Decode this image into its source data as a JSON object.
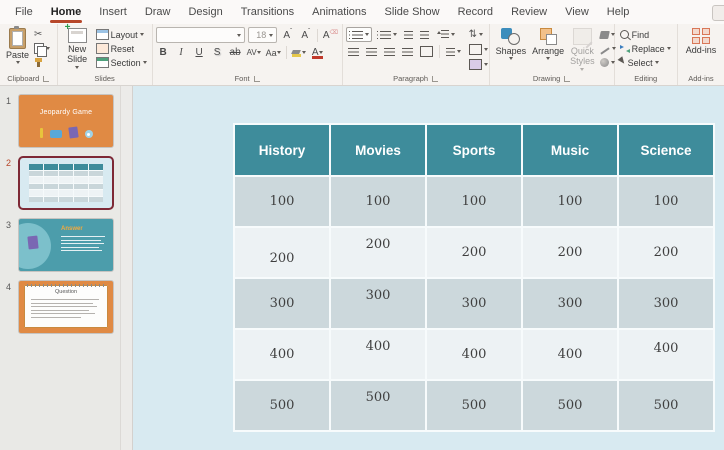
{
  "menu": {
    "tabs": [
      "File",
      "Home",
      "Insert",
      "Draw",
      "Design",
      "Transitions",
      "Animations",
      "Slide Show",
      "Record",
      "Review",
      "View",
      "Help"
    ]
  },
  "ribbon": {
    "clipboard": {
      "paste": "Paste",
      "label": "Clipboard"
    },
    "slides": {
      "new_slide": "New Slide",
      "layout": "Layout",
      "reset": "Reset",
      "section": "Section",
      "label": "Slides"
    },
    "font": {
      "size": "18",
      "grow": "A",
      "shrink": "A",
      "clear": "A",
      "bold": "B",
      "italic": "I",
      "underline": "U",
      "shadow": "S",
      "strike_ab": "ab",
      "spacing": "AV",
      "case": "Aa",
      "color": "A",
      "label": "Font"
    },
    "paragraph": {
      "label": "Paragraph"
    },
    "drawing": {
      "shapes": "Shapes",
      "arrange": "Arrange",
      "quick_styles": "Quick Styles",
      "label": "Drawing"
    },
    "editing": {
      "find": "Find",
      "replace": "Replace",
      "select": "Select",
      "label": "Editing"
    },
    "addins": {
      "button": "Add-ins",
      "label": "Add-ins"
    }
  },
  "thumbnails": [
    {
      "number": "1",
      "title": "Jeopardy Game"
    },
    {
      "number": "2"
    },
    {
      "number": "3",
      "title": "Answer"
    },
    {
      "number": "4",
      "title": "Question"
    }
  ],
  "slide": {
    "table": {
      "headers": [
        "History",
        "Movies",
        "Sports",
        "Music",
        "Science"
      ],
      "rows": [
        [
          "100",
          "100",
          "100",
          "100",
          "100"
        ],
        [
          "200",
          "200",
          "200",
          "200",
          "200"
        ],
        [
          "300",
          "300",
          "300",
          "300",
          "300"
        ],
        [
          "400",
          "400",
          "400",
          "400",
          "400"
        ],
        [
          "500",
          "500",
          "500",
          "500",
          "500"
        ]
      ]
    }
  },
  "colors": {
    "accent_teal": "#3E8C9B",
    "row_dark": "#CCD8DC",
    "row_light": "#EDF2F4",
    "slide_bg": "#D8EAF1",
    "orange": "#E08A44",
    "selected_border": "#7E2936",
    "menu_accent": "#B7472A"
  }
}
